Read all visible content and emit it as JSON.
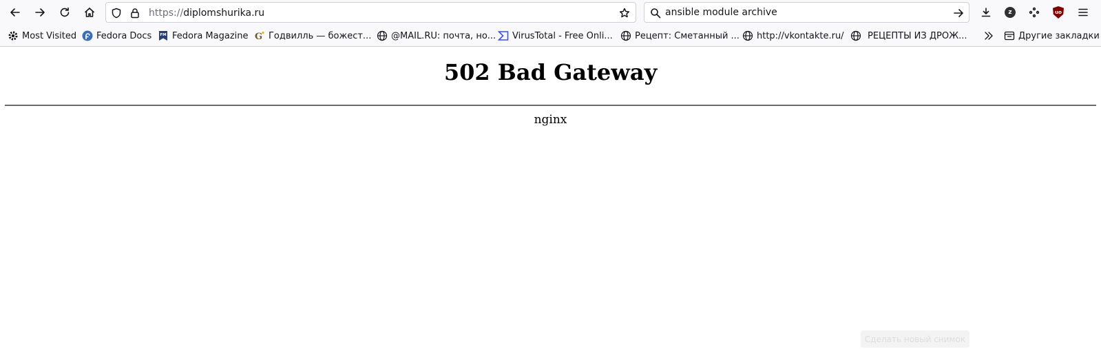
{
  "browser": {
    "url_scheme": "https://",
    "url_host": "diplomshurika.ru",
    "search_value": "ansible module archive",
    "extensions": {
      "zotero_label": "z",
      "ublock_label": "uo"
    }
  },
  "bookmarks": [
    {
      "label": "Most Visited",
      "icon": "gear-icon"
    },
    {
      "label": "Fedora Docs",
      "icon": "fedora-icon"
    },
    {
      "label": "Fedora Magazine",
      "icon": "fedora-magazine-icon"
    },
    {
      "label": "Годвилль — божест...",
      "icon": "godville-icon"
    },
    {
      "label": "@MAIL.RU: почта, но...",
      "icon": "globe-icon"
    },
    {
      "label": "VirusTotal - Free Onli...",
      "icon": "virustotal-icon"
    },
    {
      "label": "Рецепт: Сметанный ...",
      "icon": "globe-icon"
    },
    {
      "label": "http://vkontakte.ru/",
      "icon": "globe-icon"
    },
    {
      "label": "РЕЦЕПТЫ ИЗ ДРОЖ...",
      "icon": "globe-icon"
    }
  ],
  "other_bookmarks": {
    "label": "Другие закладки",
    "icon": "folder-icon"
  },
  "page": {
    "heading": "502 Bad Gateway",
    "server": "nginx"
  },
  "snapshot_button": "Сделать новый снимок",
  "colors": {
    "accent_ublock": "#800000",
    "zotero_badge": "#303030",
    "fedora_blue": "#3c6eb4"
  }
}
